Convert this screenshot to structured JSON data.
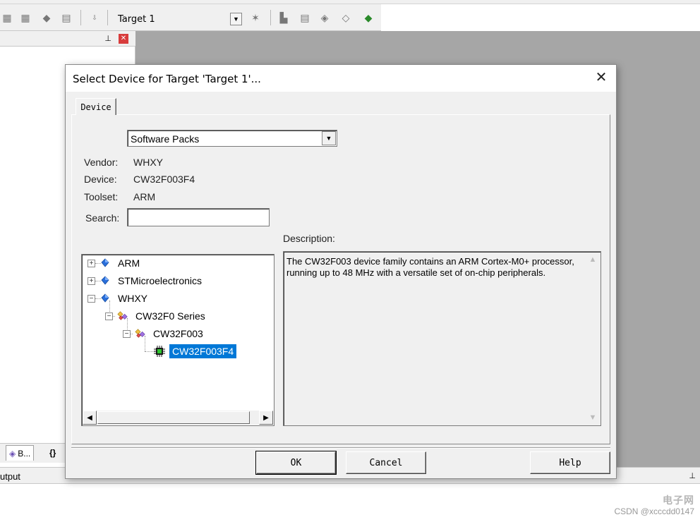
{
  "ide": {
    "target_select": "Target 1",
    "output_label": "utput",
    "proj_tabs": [
      "B...",
      "{}"
    ]
  },
  "dialog": {
    "title": "Select Device for Target 'Target 1'...",
    "tab_label": "Device",
    "pack_select": "Software Packs",
    "vendor_label": "Vendor:",
    "vendor_value": "WHXY",
    "device_label": "Device:",
    "device_value": "CW32F003F4",
    "toolset_label": "Toolset:",
    "toolset_value": "ARM",
    "search_label": "Search:",
    "search_value": "",
    "description_label": "Description:",
    "description_text": "The CW32F003 device family contains an ARM Cortex-M0+ processor, running up to 48 MHz with a versatile set of on-chip peripherals.",
    "tree": [
      {
        "label": "ARM",
        "expander": "+",
        "icon": "vendor-diamond-icon"
      },
      {
        "label": "STMicroelectronics",
        "expander": "+",
        "icon": "vendor-diamond-icon"
      },
      {
        "label": "WHXY",
        "expander": "−",
        "icon": "vendor-diamond-icon"
      },
      {
        "label": "CW32F0 Series",
        "expander": "−",
        "icon": "device-family-icon"
      },
      {
        "label": "CW32F003",
        "expander": "−",
        "icon": "device-subfamily-icon"
      },
      {
        "label": "CW32F003F4",
        "expander": "",
        "icon": "chip-icon",
        "selected": true
      }
    ],
    "buttons": {
      "ok": "OK",
      "cancel": "Cancel",
      "help": "Help"
    }
  },
  "watermark": {
    "logo": "电子网",
    "text": "CSDN @xcccdd0147"
  },
  "colors": {
    "selection": "#0078d7",
    "dialog_bg": "#f0f0f0",
    "workspace_gray": "#a6a6a6"
  }
}
